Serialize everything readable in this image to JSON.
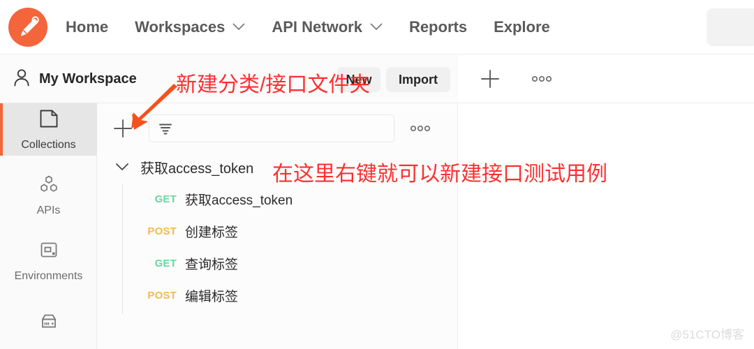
{
  "app": {
    "logo_icon": "postman-logo-icon",
    "brand_color": "#f4653b"
  },
  "header": {
    "nav": [
      {
        "label": "Home",
        "has_caret": false
      },
      {
        "label": "Workspaces",
        "has_caret": true
      },
      {
        "label": "API Network",
        "has_caret": true
      },
      {
        "label": "Reports",
        "has_caret": false
      },
      {
        "label": "Explore",
        "has_caret": false
      }
    ],
    "search_icon": "search-box"
  },
  "workspace_bar": {
    "user_icon": "user-icon",
    "workspace_name": "My Workspace",
    "new_label": "New",
    "import_label": "Import"
  },
  "tabstrip": {
    "plus_icon": "plus-icon",
    "more_icon": "ellipsis-icon"
  },
  "rail": {
    "items": [
      {
        "label": "Collections",
        "icon": "collections-icon",
        "active": true
      },
      {
        "label": "APIs",
        "icon": "apis-icon",
        "active": false
      },
      {
        "label": "Environments",
        "icon": "environments-icon",
        "active": false
      },
      {
        "label": "",
        "icon": "mock-servers-icon",
        "active": false
      }
    ]
  },
  "sidebar": {
    "add_icon": "plus-icon",
    "filter_icon": "filter-icon",
    "search_placeholder": "",
    "search_value": "",
    "more_icon": "ellipsis-icon",
    "tree": {
      "folder": {
        "name": "获取access_token",
        "expanded": true,
        "chevron_icon": "chevron-down-icon"
      },
      "requests": [
        {
          "method": "GET",
          "name": "获取access_token"
        },
        {
          "method": "POST",
          "name": "创建标签"
        },
        {
          "method": "GET",
          "name": "查询标签"
        },
        {
          "method": "POST",
          "name": "编辑标签"
        }
      ]
    }
  },
  "annotations": {
    "top_note": "新建分类/接口文件夹",
    "tree_note": "在这里右键就可以新建接口测试用例",
    "arrow_icon": "arrow-pointing-down-left-icon",
    "color": "#fc3030"
  },
  "watermark": {
    "text": "@51CTO博客"
  },
  "method_colors": {
    "get": "#6bd5a0",
    "post": "#f2b950"
  }
}
